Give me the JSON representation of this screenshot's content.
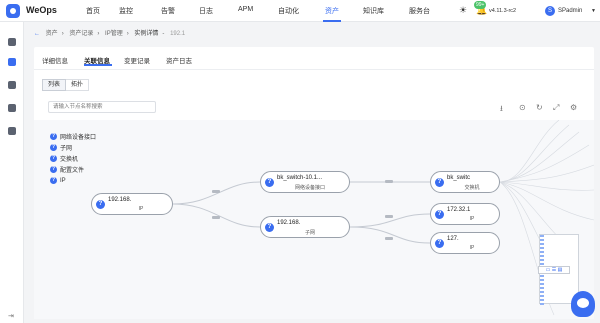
{
  "app": {
    "name": "WeOps",
    "version": "v4.11.3-rc2",
    "badge": "99+",
    "user": "SPadmin",
    "nav": [
      "首页",
      "监控",
      "告警",
      "日志",
      "APM",
      "自动化",
      "资产",
      "知识库",
      "服务台"
    ],
    "active_nav": "资产"
  },
  "breadcrumb": [
    "资产",
    "资产记录",
    "IP管理",
    "实例详情",
    "192.1"
  ],
  "tabs": [
    "详细信息",
    "关联信息",
    "变更记录",
    "资产日志"
  ],
  "active_tab": "关联信息",
  "view_toggle": [
    "列表",
    "拓扑"
  ],
  "search": {
    "placeholder": "请输入节点名称搜索"
  },
  "legend": [
    "网络设备接口",
    "子网",
    "交换机",
    "配置文件",
    "IP"
  ],
  "nodes": [
    {
      "label": "192.168.",
      "type": "IP"
    },
    {
      "label": "bk_switch-10.1...",
      "type": "网络设备接口"
    },
    {
      "label": "192.168.",
      "type": "子网"
    },
    {
      "label": "bk_switc",
      "type": "交换机"
    },
    {
      "label": "172.32.1",
      "type": "IP"
    },
    {
      "label": "127.",
      "type": "IP"
    }
  ],
  "icons": {
    "theme": "sun-icon",
    "notifications": "bell-icon",
    "toolbar": [
      "download-icon",
      "target-icon",
      "refresh-icon",
      "fullscreen-icon",
      "settings-icon"
    ]
  },
  "colors": {
    "accent": "#3a6df0",
    "badge": "#4cc36a"
  }
}
